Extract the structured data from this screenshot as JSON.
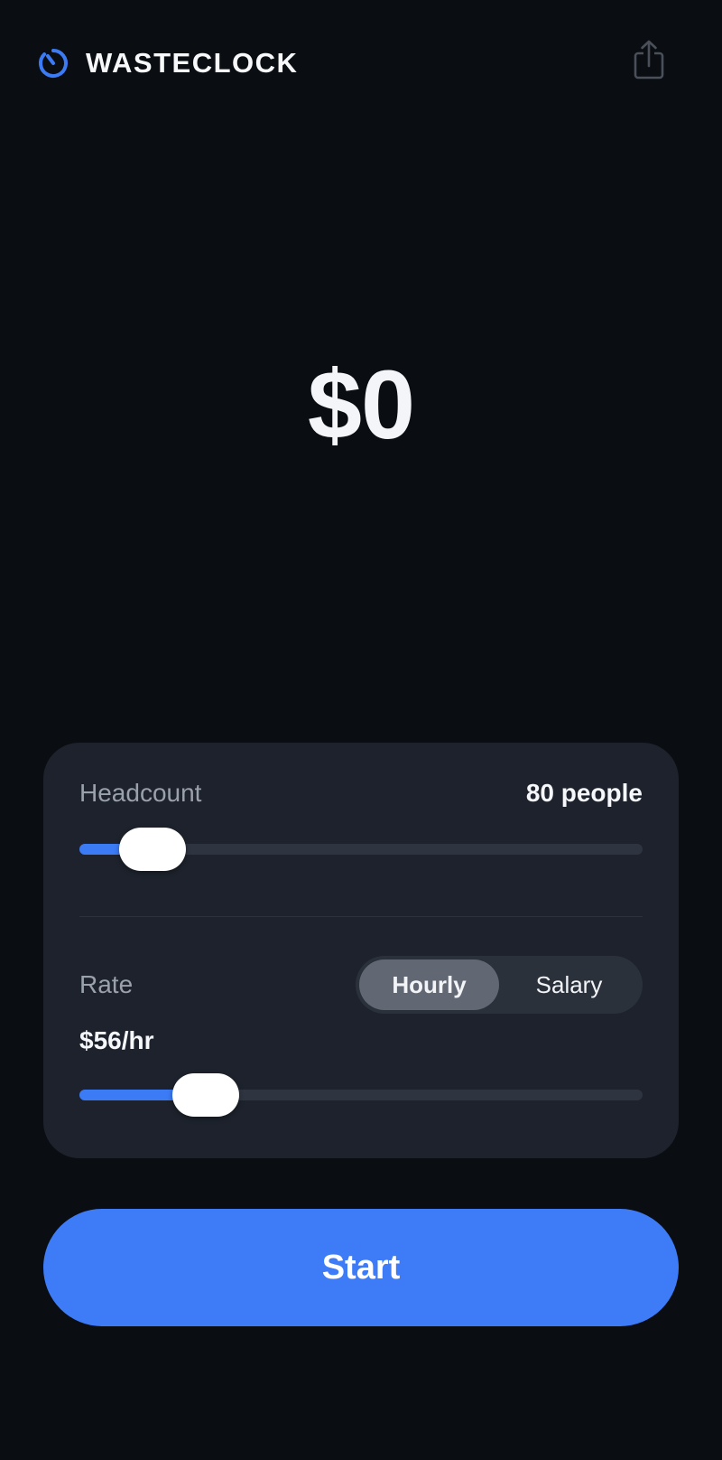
{
  "app": {
    "brand": "WASTECLOCK",
    "accent_color": "#3B7BF6",
    "share_icon": "share-icon",
    "logo_icon": "stopwatch-icon"
  },
  "counter": {
    "amount": "$0"
  },
  "settings": {
    "headcount": {
      "label": "Headcount",
      "value_text": "80 people",
      "slider_fraction": 0.13
    },
    "rate": {
      "label": "Rate",
      "value_text": "$56/hr",
      "slider_fraction": 0.225,
      "modes": [
        {
          "label": "Hourly",
          "selected": true
        },
        {
          "label": "Salary",
          "selected": false
        }
      ]
    }
  },
  "actions": {
    "start_label": "Start"
  }
}
